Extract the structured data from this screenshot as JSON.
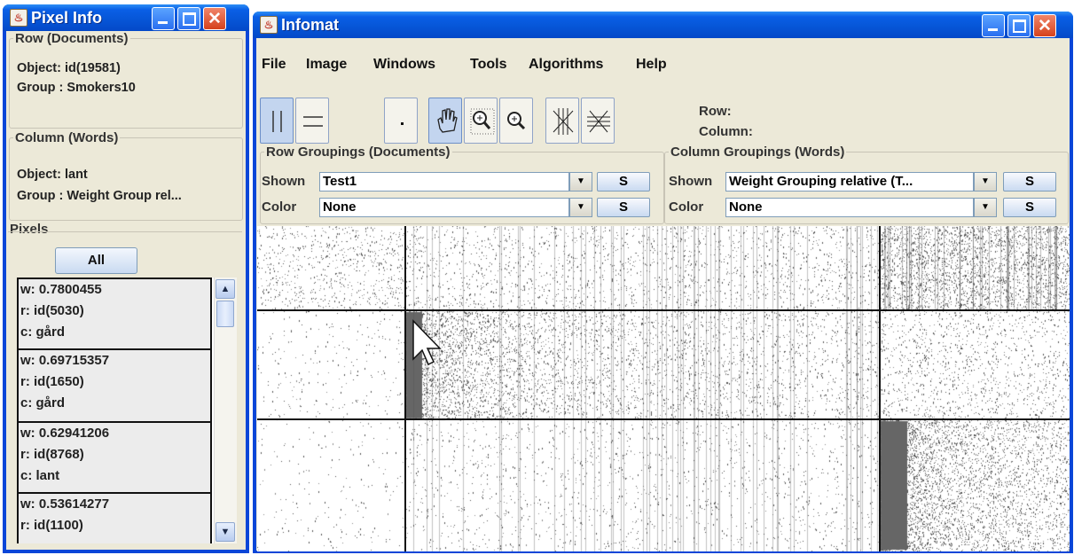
{
  "pixel_info": {
    "title": "Pixel Info",
    "row_group": {
      "legend": "Row (Documents)",
      "object": "Object: id(19581)",
      "group": "Group : Smokers10"
    },
    "column_group": {
      "legend": "Column (Words)",
      "object": "Object: lant",
      "group": "Group : Weight Group rel..."
    },
    "pixels_label": "Pixels",
    "all_button": "All",
    "items": [
      {
        "w": "w: 0.7800455",
        "r": "r:  id(5030)",
        "c": "c:  gård"
      },
      {
        "w": "w: 0.69715357",
        "r": "r:  id(1650)",
        "c": "c:  gård"
      },
      {
        "w": "w: 0.62941206",
        "r": "r:  id(8768)",
        "c": "c:  lant"
      },
      {
        "w": "w: 0.53614277",
        "r": "r:  id(1100)",
        "c": ""
      }
    ]
  },
  "infomat": {
    "title": "Infomat",
    "menu": [
      "File",
      "Image",
      "Windows",
      "Tools",
      "Algorithms",
      "Help"
    ],
    "tools": [
      "rows-tool-icon",
      "columns-tool-icon",
      "point-icon",
      "hand-icon",
      "zoom-region-icon",
      "zoom-in-icon",
      "strike-vertical-icon",
      "strike-horizontal-icon"
    ],
    "row_label": "Row:",
    "column_label": "Column:",
    "row_groupings": {
      "legend": "Row Groupings (Documents)",
      "shown_label": "Shown",
      "shown_value": "Test1",
      "color_label": "Color",
      "color_value": "None",
      "s1": "S",
      "s2": "S"
    },
    "column_groupings": {
      "legend": "Column Groupings (Words)",
      "shown_label": "Shown",
      "shown_value": "Weight Grouping relative (T...",
      "color_label": "Color",
      "color_value": "None",
      "s1": "S",
      "s2": "S"
    }
  },
  "colors": {
    "titlebar": "#0a5fe6",
    "window_bg": "#ece9d8",
    "matrix_dot": "#555555"
  }
}
